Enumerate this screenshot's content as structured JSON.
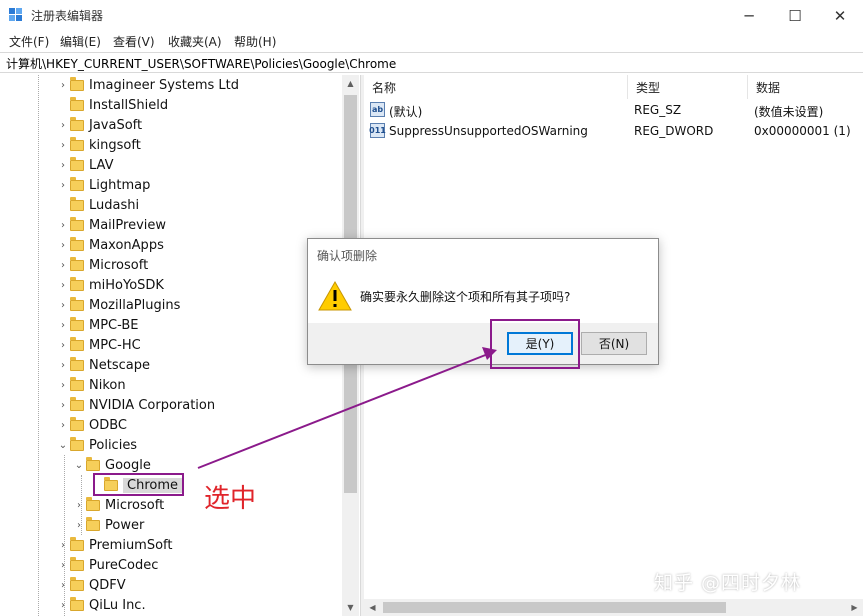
{
  "window": {
    "title": "注册表编辑器",
    "minimize_glyph": "─",
    "maximize_glyph": "☐",
    "close_glyph": "✕"
  },
  "menu": {
    "items": [
      "文件(F)",
      "编辑(E)",
      "查看(V)",
      "收藏夹(A)",
      "帮助(H)"
    ]
  },
  "address": {
    "path": "计算机\\HKEY_CURRENT_USER\\SOFTWARE\\Policies\\Google\\Chrome"
  },
  "tree": {
    "items": [
      {
        "label": "Imagineer Systems Ltd",
        "twisty": "›"
      },
      {
        "label": "InstallShield",
        "twisty": ""
      },
      {
        "label": "JavaSoft",
        "twisty": "›"
      },
      {
        "label": "kingsoft",
        "twisty": "›"
      },
      {
        "label": "LAV",
        "twisty": "›"
      },
      {
        "label": "Lightmap",
        "twisty": "›"
      },
      {
        "label": "Ludashi",
        "twisty": ""
      },
      {
        "label": "MailPreview",
        "twisty": "›"
      },
      {
        "label": "MaxonApps",
        "twisty": "›"
      },
      {
        "label": "Microsoft",
        "twisty": "›"
      },
      {
        "label": "miHoYoSDK",
        "twisty": "›"
      },
      {
        "label": "MozillaPlugins",
        "twisty": "›"
      },
      {
        "label": "MPC-BE",
        "twisty": "›"
      },
      {
        "label": "MPC-HC",
        "twisty": "›"
      },
      {
        "label": "Netscape",
        "twisty": "›"
      },
      {
        "label": "Nikon",
        "twisty": "›"
      },
      {
        "label": "NVIDIA Corporation",
        "twisty": "›"
      },
      {
        "label": "ODBC",
        "twisty": "›"
      },
      {
        "label": "Policies",
        "twisty": "⌄"
      },
      {
        "label": "Google",
        "twisty": "⌄"
      },
      {
        "label": "Chrome",
        "twisty": ""
      },
      {
        "label": "Microsoft",
        "twisty": "›"
      },
      {
        "label": "Power",
        "twisty": "›"
      },
      {
        "label": "PremiumSoft",
        "twisty": "›"
      },
      {
        "label": "PureCodec",
        "twisty": "›"
      },
      {
        "label": "QDFV",
        "twisty": "›"
      },
      {
        "label": "QiLu Inc.",
        "twisty": "›"
      }
    ]
  },
  "list": {
    "columns": [
      "名称",
      "类型",
      "数据"
    ],
    "rows": [
      {
        "icon": "ab",
        "name": "(默认)",
        "type": "REG_SZ",
        "data": "(数值未设置)"
      },
      {
        "icon": "011",
        "name": "SuppressUnsupportedOSWarning",
        "type": "REG_DWORD",
        "data": "0x00000001 (1)"
      }
    ]
  },
  "dialog": {
    "title": "确认项删除",
    "message": "确实要永久删除这个项和所有其子项吗?",
    "yes_label": "是(Y)",
    "no_label": "否(N)"
  },
  "annotation": {
    "text": "选中",
    "color": "#e0242a",
    "box_color": "#8b1a8b"
  },
  "watermark": {
    "text": "知乎 @四时夕林"
  }
}
